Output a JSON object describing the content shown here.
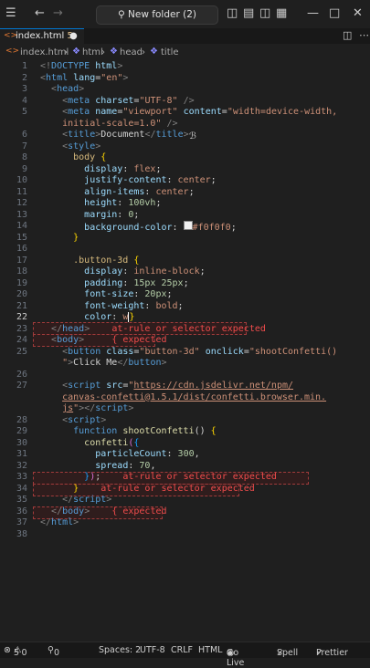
{
  "titlebar": {
    "search_text": "New folder (2)"
  },
  "tab": {
    "filename": "index.html",
    "badge": "5"
  },
  "breadcrumb": {
    "file": "index.html",
    "items": [
      "html",
      "head",
      "title"
    ]
  },
  "errors": {
    "e23": "at-rule or selector expected",
    "e24": "{ expected",
    "e33": "at-rule or selector expected",
    "e34": "at-rule or selector expected",
    "e36": "{ expected"
  },
  "status": {
    "errors": "5",
    "warnings": "0",
    "infos": "0",
    "spaces": "Spaces: 2",
    "encoding": "UTF-8",
    "eol": "CRLF",
    "lang": "HTML",
    "golive": "Go Live",
    "spell": "Spell",
    "prettier": "Prettier"
  }
}
